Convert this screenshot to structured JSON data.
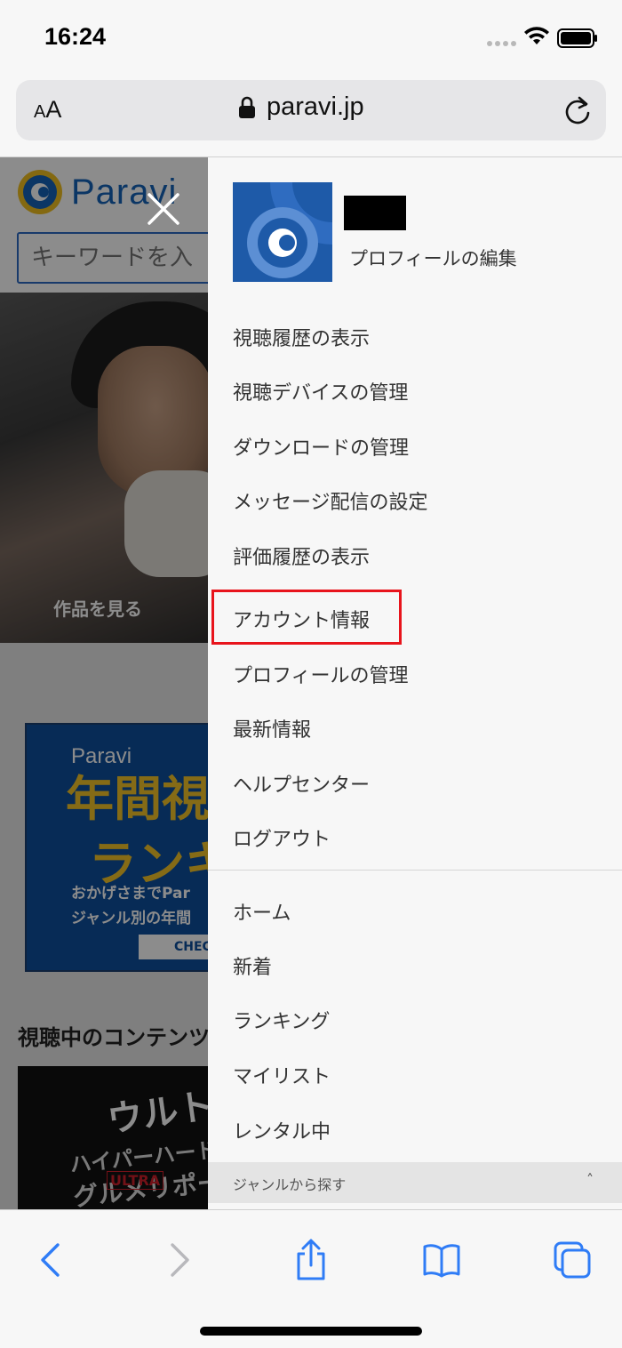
{
  "status_bar": {
    "time": "16:24"
  },
  "address_bar": {
    "aa_small": "A",
    "aa_big": "A",
    "url": "paravi.jp"
  },
  "page": {
    "logo_text": "Paravi",
    "search_placeholder": "キーワードを入",
    "hero_button": "作品を見る",
    "banner": {
      "brand": "Paravi",
      "headline_1": "年間視",
      "headline_2": "ランキ",
      "body_1": "おかげさまでPar",
      "body_2": "ジャンル別の年間",
      "cta": "CHEC"
    },
    "section_title": "視聴中のコンテンツ",
    "thumbnail": {
      "title": "ウルト",
      "subtitle": "ハイパーハードボイ",
      "subtitle2": "グルメリポー",
      "badge": "ULTRA"
    }
  },
  "drawer": {
    "profile_edit": "プロフィールの編集",
    "account_menu": [
      "視聴履歴の表示",
      "視聴デバイスの管理",
      "ダウンロードの管理",
      "メッセージ配信の設定",
      "評価履歴の表示",
      "アカウント情報",
      "プロフィールの管理",
      "最新情報",
      "ヘルプセンター",
      "ログアウト"
    ],
    "nav_menu": [
      "ホーム",
      "新着",
      "ランキング",
      "マイリスト",
      "レンタル中"
    ],
    "genre_label": "ジャンルから探す",
    "genre_chevron": "˄",
    "highlight_color": "#e8141c"
  },
  "toolbar": {
    "icons": [
      "back-icon",
      "forward-icon",
      "share-icon",
      "bookmarks-icon",
      "tabs-icon"
    ]
  }
}
